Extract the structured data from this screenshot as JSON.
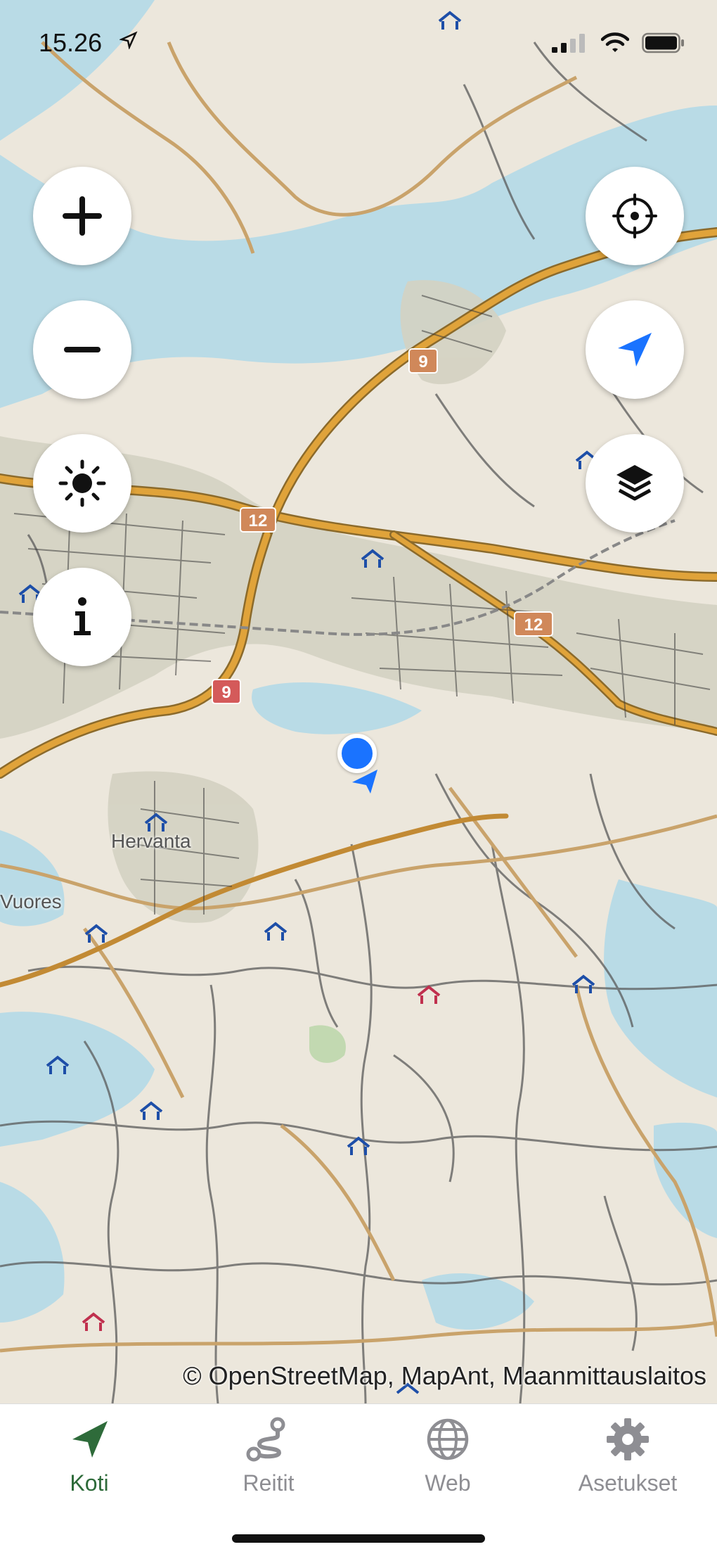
{
  "status_bar": {
    "time": "15.26",
    "icons": [
      "location-arrow-icon",
      "signal-icon",
      "wifi-icon",
      "battery-icon"
    ]
  },
  "map": {
    "place_labels": [
      "Hervanta",
      "Vuores"
    ],
    "road_badges": [
      "9",
      "12",
      "12",
      "9"
    ],
    "attribution": "© OpenStreetMap, MapAnt, Maanmittauslaitos",
    "colors": {
      "land": "#ece7dc",
      "water": "#b9dbe6",
      "road_major": "#e0a33a",
      "road_minor": "#c9a36b",
      "track": "#5a5a5a",
      "urban": "#d6d3c4",
      "user_dot": "#1a73ff"
    }
  },
  "controls": {
    "left": [
      "zoom-in",
      "zoom-out",
      "brightness",
      "info"
    ],
    "right": [
      "recenter",
      "navigate",
      "layers"
    ]
  },
  "tabs": [
    {
      "label": "Koti",
      "icon": "navigate-icon",
      "active": true
    },
    {
      "label": "Reitit",
      "icon": "route-icon",
      "active": false
    },
    {
      "label": "Web",
      "icon": "globe-icon",
      "active": false
    },
    {
      "label": "Asetukset",
      "icon": "gear-icon",
      "active": false
    }
  ]
}
